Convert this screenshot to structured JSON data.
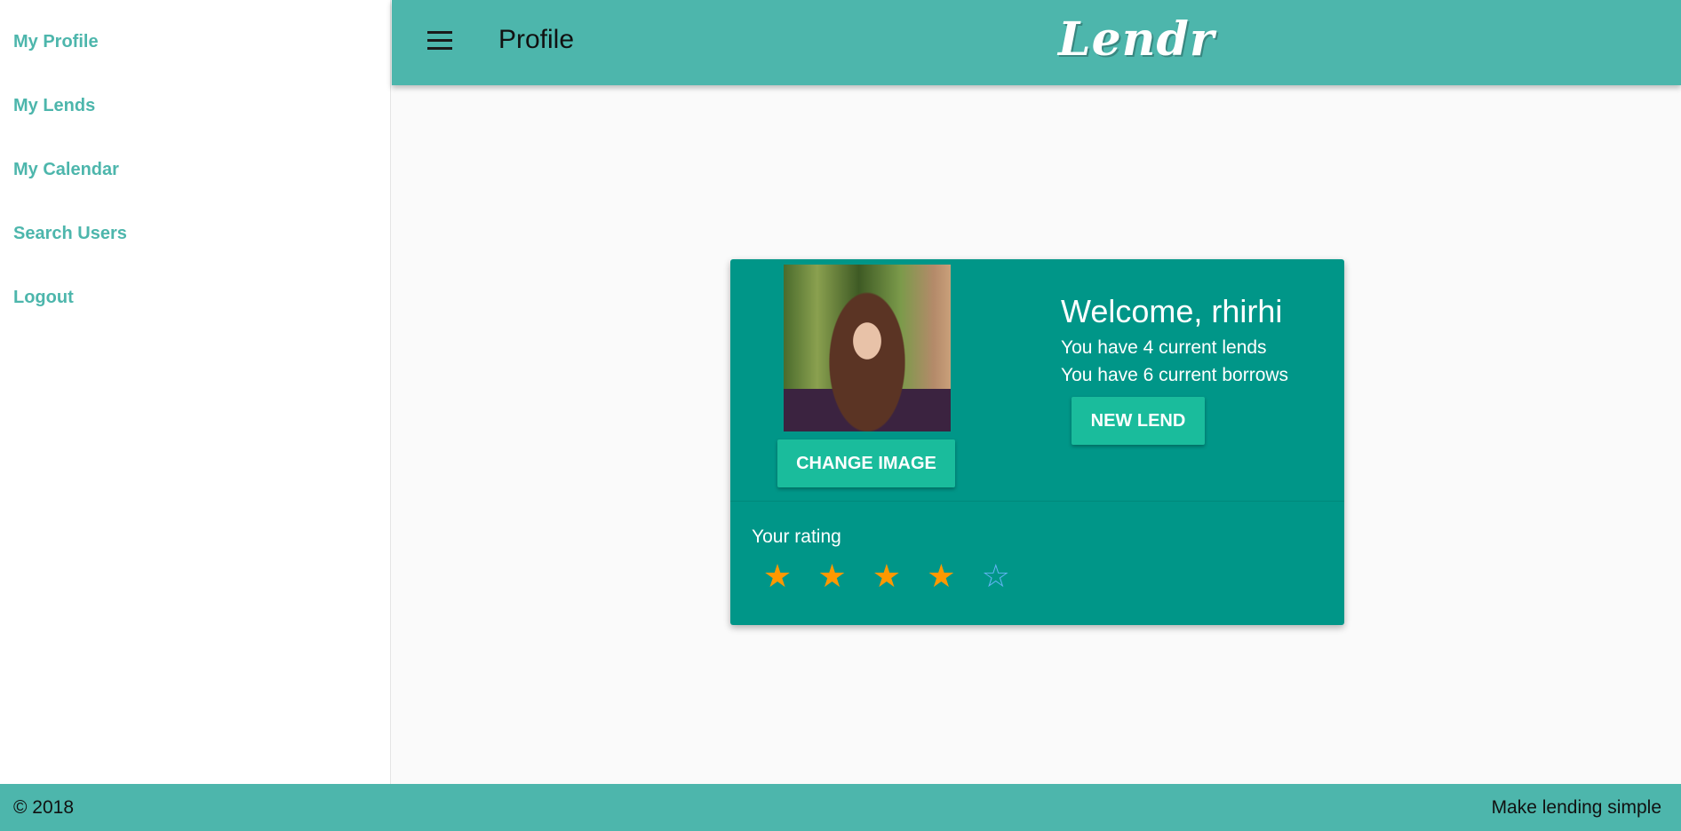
{
  "sidebar": {
    "items": [
      {
        "label": "My Profile"
      },
      {
        "label": "My Lends"
      },
      {
        "label": "My Calendar"
      },
      {
        "label": "Search Users"
      },
      {
        "label": "Logout"
      }
    ]
  },
  "header": {
    "menu_icon": "hamburger-menu-icon",
    "title": "Profile",
    "logo_text": "Lendr"
  },
  "profile_card": {
    "welcome": "Welcome, rhirhi",
    "lends_text": "You have 4 current lends",
    "borrows_text": "You have 6 current borrows",
    "change_image_label": "CHANGE IMAGE",
    "new_lend_label": "NEW LEND",
    "rating_label": "Your rating",
    "rating_value": 4,
    "rating_max": 5,
    "star_filled_color": "#ff9800",
    "star_empty_color": "#64b5f6"
  },
  "footer": {
    "copyright": "© 2018",
    "tagline": "Make lending simple"
  },
  "colors": {
    "primary": "#4db6ac",
    "card": "#009688",
    "button": "#1abc9c"
  }
}
